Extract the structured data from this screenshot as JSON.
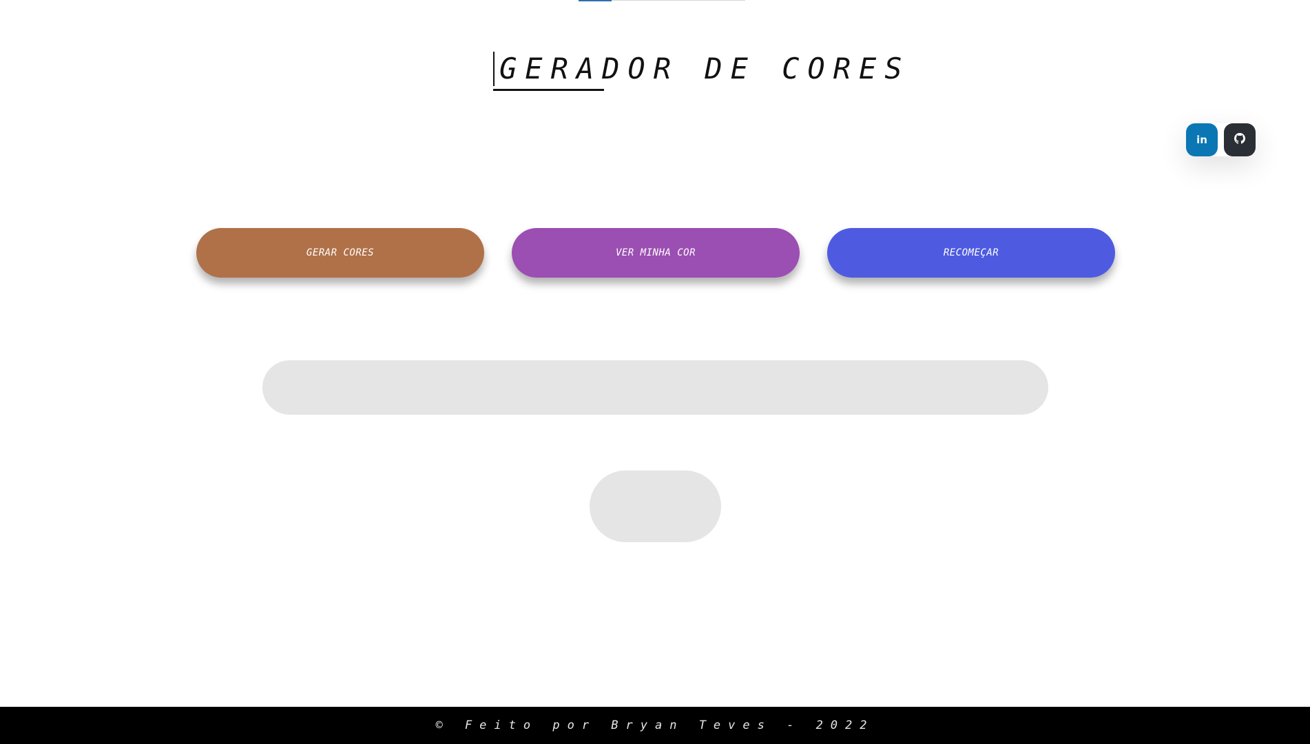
{
  "header": {
    "title": "GERADOR DE CORES"
  },
  "social": {
    "linkedin": {
      "icon": "linkedin-icon",
      "glyph": "in",
      "color": "#0a76b4"
    },
    "github": {
      "icon": "github-icon",
      "glyph": "●",
      "color": "#2a2f35"
    }
  },
  "actions": {
    "generate": {
      "label": "GERAR CORES",
      "color": "#b07149"
    },
    "view": {
      "label": "VER MINHA COR",
      "color": "#9b4fb2"
    },
    "restart": {
      "label": "RECOMEÇAR",
      "color": "#4e5be1"
    }
  },
  "output": {
    "color_bar_text": "",
    "swatch_text": ""
  },
  "footer": {
    "text": "© Feito por Bryan Teves - 2022"
  }
}
